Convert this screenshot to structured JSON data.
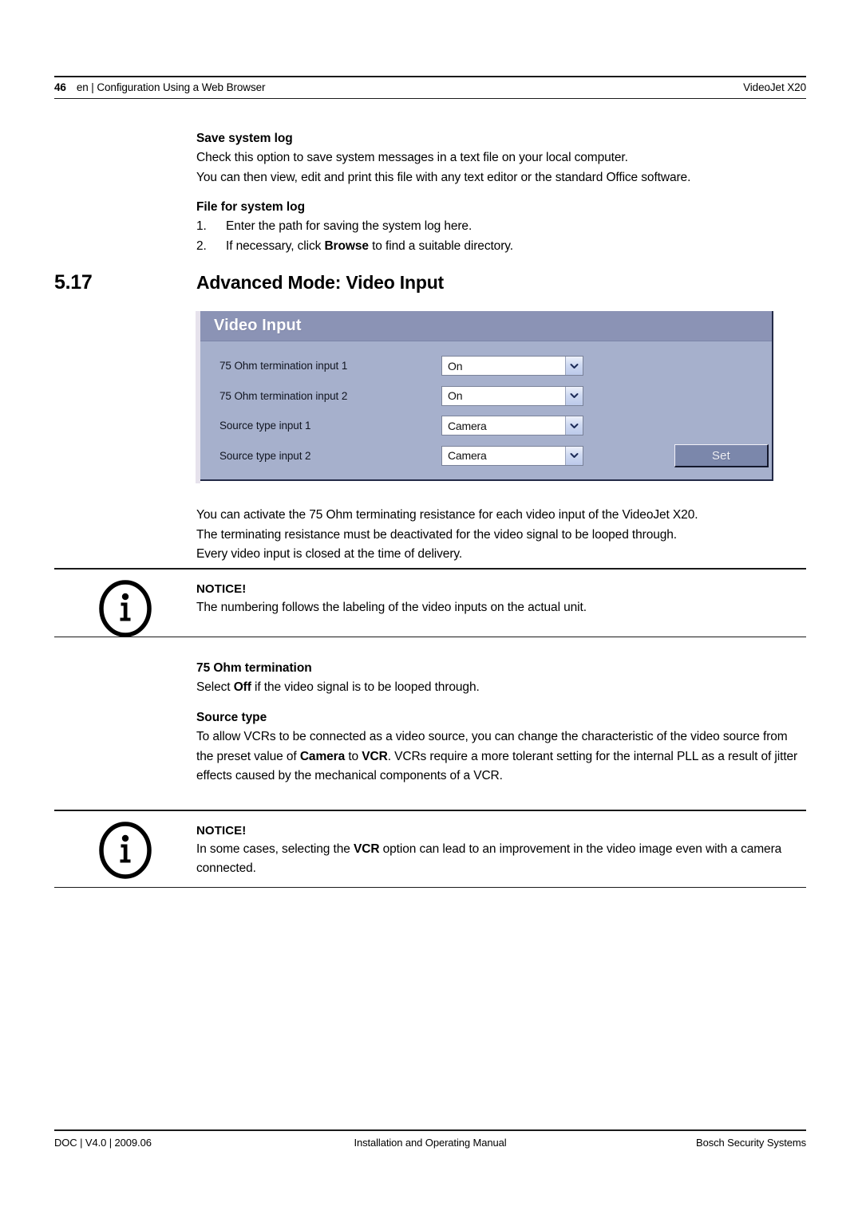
{
  "header": {
    "page_number": "46",
    "left_text": "en | Configuration Using a Web Browser",
    "right_text": "VideoJet X20"
  },
  "save_system_log": {
    "heading": "Save system log",
    "line1": "Check this option to save system messages in a text file on your local computer.",
    "line2": "You can then view, edit and print this file with any text editor or the standard Office software."
  },
  "file_for_system_log": {
    "heading": "File for system log",
    "items": [
      {
        "num": "1.",
        "text": "Enter the path for saving the system log here."
      },
      {
        "num": "2.",
        "pre": "If necessary, click ",
        "bold": "Browse",
        "post": " to find a suitable directory."
      }
    ]
  },
  "section": {
    "number": "5.17",
    "title": "Advanced Mode: Video Input"
  },
  "video_input_panel": {
    "title": "Video Input",
    "rows": [
      {
        "label": "75 Ohm termination input 1",
        "value": "On"
      },
      {
        "label": "75 Ohm termination input 2",
        "value": "On"
      },
      {
        "label": "Source type input 1",
        "value": "Camera"
      },
      {
        "label": "Source type input 2",
        "value": "Camera"
      }
    ],
    "set_button": "Set",
    "colors": {
      "titlebar": "#8b93b5",
      "body": "#a6b0cc",
      "border": "#232a47",
      "button": "#7b87ab"
    }
  },
  "after_panel": {
    "line1": "You can activate the 75 Ohm terminating resistance for each video input of the VideoJet X20.",
    "line2": "The terminating resistance must be deactivated for the video signal to be looped through.",
    "line3": "Every video input is closed at the time of delivery."
  },
  "notice_1": {
    "title": "NOTICE!",
    "body": "The numbering follows the labeling of the video inputs on the actual unit.",
    "icon": "info-icon"
  },
  "termination_75ohm": {
    "heading": "75 Ohm termination",
    "pre": "Select ",
    "bold": "Off",
    "post": " if the video signal is to be looped through."
  },
  "source_type": {
    "heading": "Source type",
    "p1_pre": "To allow VCRs to be connected as a video source, you can change the characteristic of the video source from the preset value of ",
    "p1_bold1": "Camera",
    "p1_mid": " to ",
    "p1_bold2": "VCR",
    "p1_post": ".  VCRs require a more tolerant setting for the internal PLL as a result of jitter effects caused by the mechanical components of a VCR."
  },
  "notice_2": {
    "title": "NOTICE!",
    "pre": "In some cases, selecting the ",
    "bold": "VCR",
    "post": " option can lead to an improvement in the video image even with a camera connected.",
    "icon": "info-icon"
  },
  "footer": {
    "left": "DOC | V4.0 | 2009.06",
    "center": "Installation and Operating Manual",
    "right": "Bosch Security Systems"
  }
}
